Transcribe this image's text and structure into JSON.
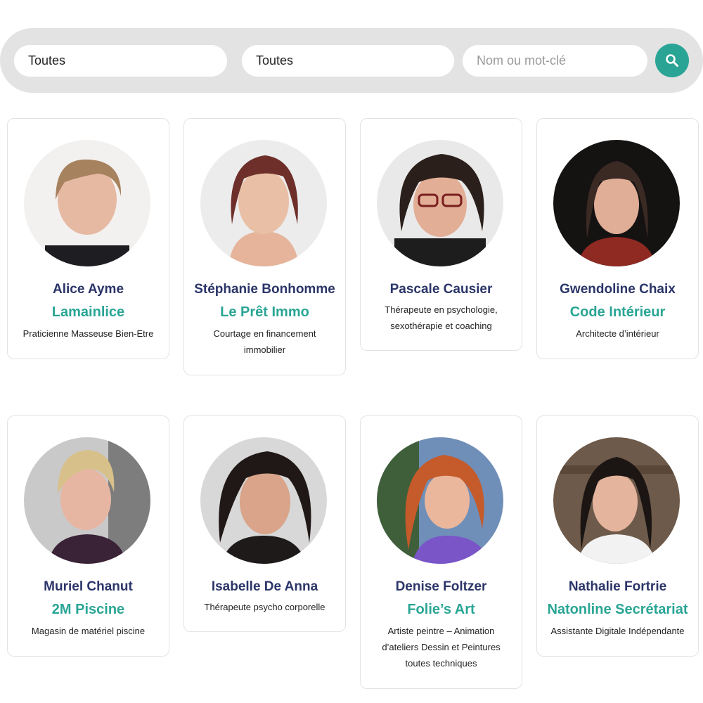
{
  "search": {
    "filter1_value": "Toutes",
    "filter2_value": "Toutes",
    "keyword_placeholder": "Nom ou mot-clé",
    "search_icon": "search-icon",
    "accent_color": "#2aa595"
  },
  "members": [
    {
      "name": "Alice Ayme",
      "company": "Lamainlice",
      "description": "Praticienne Masseuse Bien-Etre"
    },
    {
      "name": "Stéphanie Bonhomme",
      "company": "Le Prêt Immo",
      "description": "Courtage en financement immobilier"
    },
    {
      "name": "Pascale Causier",
      "company": "",
      "description": "Thérapeute en psychologie, sexothérapie et coaching"
    },
    {
      "name": "Gwendoline Chaix",
      "company": "Code Intérieur",
      "description": "Architecte d’intérieur"
    },
    {
      "name": "Muriel Chanut",
      "company": "2M Piscine",
      "description": "Magasin de matériel piscine"
    },
    {
      "name": "Isabelle De Anna",
      "company": "",
      "description": "Thérapeute psycho corporelle"
    },
    {
      "name": "Denise Foltzer",
      "company": "Folie’s Art",
      "description": "Artiste peintre – Animation d’ateliers Dessin et Peintures toutes techniques"
    },
    {
      "name": "Nathalie Fortrie",
      "company": "Natonline Secrétariat",
      "description": "Assistante Digitale Indépendante"
    }
  ],
  "colors": {
    "name": "#2b3568",
    "company": "#2aa595",
    "search_bar_bg": "#e3e3e3"
  }
}
